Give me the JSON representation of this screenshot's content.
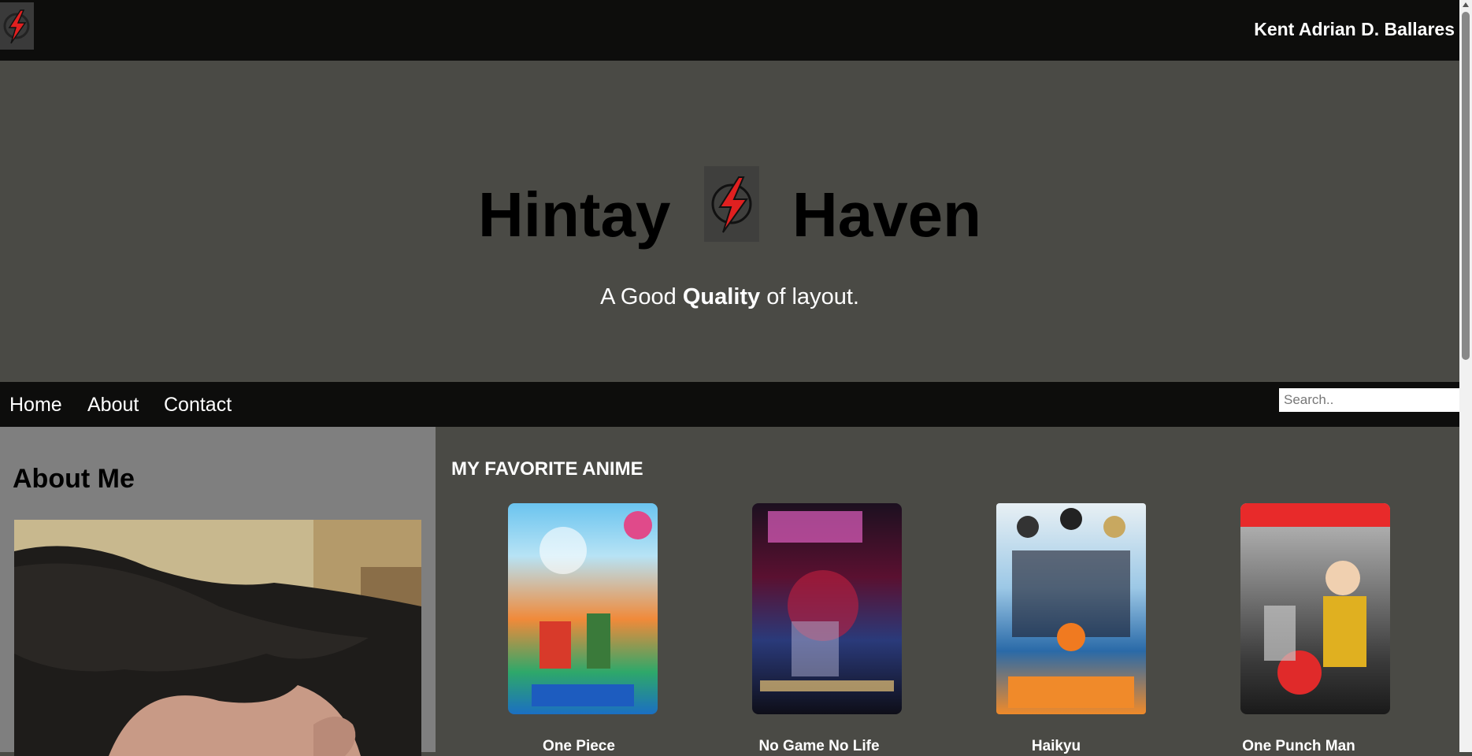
{
  "header": {
    "name": "Kent Adrian D. Ballares"
  },
  "hero": {
    "title_left": "Hintay",
    "title_right": "Haven",
    "tagline_pre": "A Good",
    "tagline_bold": "Quality",
    "tagline_post": "of layout."
  },
  "nav": {
    "items": [
      {
        "label": "Home"
      },
      {
        "label": "About"
      },
      {
        "label": "Contact"
      }
    ],
    "search_placeholder": "Search.."
  },
  "sidebar": {
    "heading": "About Me"
  },
  "main": {
    "heading": "MY FAVORITE ANIME",
    "anime": [
      {
        "title": "One Piece"
      },
      {
        "title": "No Game No Life"
      },
      {
        "title": "Haikyu"
      },
      {
        "title": "One Punch Man"
      }
    ]
  },
  "colors": {
    "bar": "#0d0d0c",
    "hero": "#4a4a45",
    "sidebar": "#7f7f7f",
    "accent": "#e02020"
  },
  "icons": {
    "logo": "lightning-bolt-icon"
  }
}
